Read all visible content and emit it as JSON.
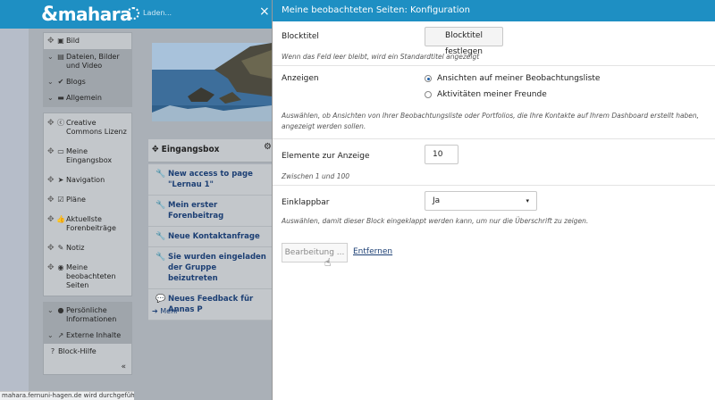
{
  "header": {
    "logo": "mahara",
    "loading_label": "Laden...",
    "close_symbol": "×"
  },
  "sidebar": {
    "groups": [
      {
        "items": [
          {
            "label": "Bild",
            "icon": "image-icon",
            "style": "plain"
          },
          {
            "label": "Dateien, Bilder und Video",
            "icon": "film-icon",
            "style": "dark",
            "collapsible": true
          },
          {
            "label": "Blogs",
            "icon": "check-icon",
            "style": "dark",
            "collapsible": true
          },
          {
            "label": "Allgemein",
            "icon": "briefcase-icon",
            "style": "dark",
            "collapsible": true
          }
        ]
      },
      {
        "items": [
          {
            "label": "Creative Commons Lizenz",
            "icon": "cc-icon"
          },
          {
            "label": "Meine Eingangsbox",
            "icon": "inbox-icon"
          },
          {
            "label": "Navigation",
            "icon": "arrow-icon"
          },
          {
            "label": "Pläne",
            "icon": "checkbox-icon"
          },
          {
            "label": "Aktuellste Forenbeiträge",
            "icon": "thumbs-up-icon"
          },
          {
            "label": "Notiz",
            "icon": "pencil-icon"
          },
          {
            "label": "Meine beobachteten Seiten",
            "icon": "eye-icon"
          }
        ]
      },
      {
        "items": [
          {
            "label": "Persönliche Informationen",
            "icon": "user-icon",
            "style": "dark",
            "collapsible": true
          },
          {
            "label": "Externe Inhalte",
            "icon": "external-link-icon",
            "style": "dark",
            "collapsible": true
          },
          {
            "label": "Block-Hilfe",
            "icon": "question-icon",
            "style": "plain"
          }
        ]
      }
    ],
    "collapse_symbol": "«"
  },
  "inbox": {
    "title": "Eingangsbox",
    "items": [
      {
        "text": "New access to page \"Lernau 1\"",
        "icon": "wrench-icon"
      },
      {
        "text": "Mein erster Forenbeitrag",
        "icon": "wrench-icon"
      },
      {
        "text": "Neue Kontaktanfrage",
        "icon": "wrench-icon"
      },
      {
        "text": "Sie wurden eingeladen der Gruppe beizutreten",
        "icon": "wrench-icon"
      },
      {
        "text": "Neues Feedback für Annas P",
        "icon": "comments-icon"
      }
    ],
    "more": "Mehr"
  },
  "statusbar": "mahara.fernuni-hagen.de wird durchgeführt...",
  "modal": {
    "title": "Meine beobachteten Seiten: Konfiguration",
    "blocktitle_label": "Blocktitel",
    "blocktitle_button": "Blocktitel festlegen",
    "blocktitle_hint": "Wenn das Feld leer bleibt, wird ein Standardtitel angezeigt",
    "show_label": "Anzeigen",
    "show_options": [
      "Ansichten auf meiner Beobachtungsliste",
      "Aktivitäten meiner Freunde"
    ],
    "show_selected": 0,
    "show_hint_1": "Auswählen, ob Ansichten von Ihrer Beobachtungsliste oder Portfolios, die Ihre Kontakte auf Ihrem Dashboard erstellt haben,",
    "show_hint_2": "angezeigt werden sollen.",
    "count_label": "Elemente zur Anzeige",
    "count_value": "10",
    "count_hint": "Zwischen 1 und 100",
    "collapsible_label": "Einklappbar",
    "collapsible_value": "Ja",
    "collapsible_hint": "Auswählen, damit dieser Block eingeklappt werden kann, um nur die Überschrift zu zeigen.",
    "edit_button": "Bearbeitung ...",
    "remove_link": "Entfernen"
  }
}
